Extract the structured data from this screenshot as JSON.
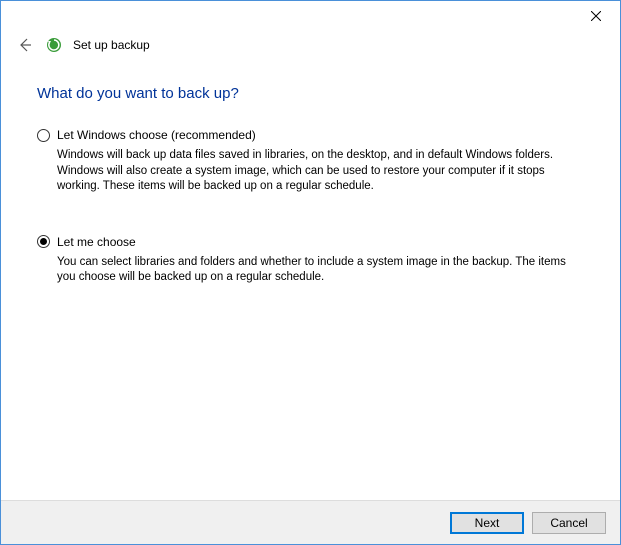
{
  "window": {
    "title": "Set up backup"
  },
  "content": {
    "question": "What do you want to back up?",
    "options": [
      {
        "label": "Let Windows choose (recommended)",
        "description": "Windows will back up data files saved in libraries, on the desktop, and in default Windows folders. Windows will also create a system image, which can be used to restore your computer if it stops working. These items will be backed up on a regular schedule.",
        "selected": false
      },
      {
        "label": "Let me choose",
        "description": "You can select libraries and folders and whether to include a system image in the backup. The items you choose will be backed up on a regular schedule.",
        "selected": true
      }
    ]
  },
  "footer": {
    "next": "Next",
    "cancel": "Cancel"
  }
}
